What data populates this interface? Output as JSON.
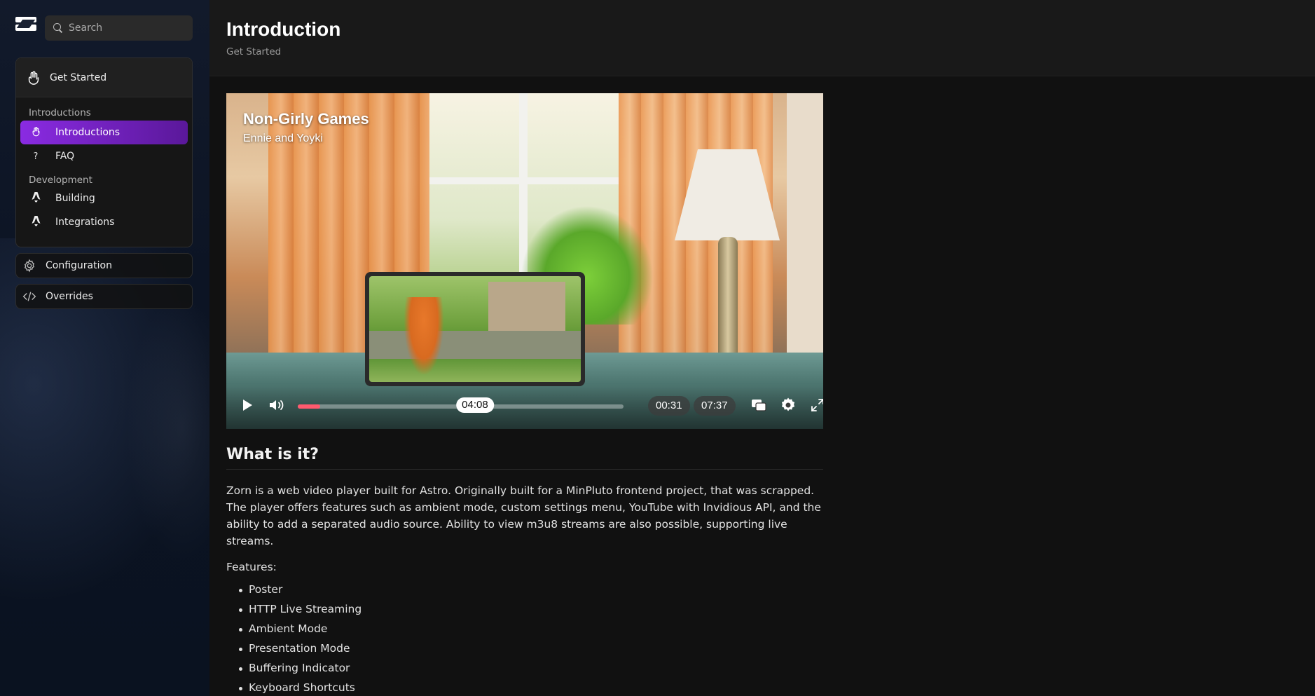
{
  "sidebar": {
    "search": {
      "placeholder": "Search"
    },
    "group": {
      "title": "Get Started",
      "sections": [
        {
          "title": "Introductions",
          "items": [
            {
              "label": "Introductions",
              "icon": "hand-icon",
              "active": true
            },
            {
              "label": "FAQ",
              "icon": "question-icon",
              "active": false
            }
          ]
        },
        {
          "title": "Development",
          "items": [
            {
              "label": "Building",
              "icon": "astro-icon",
              "active": false
            },
            {
              "label": "Integrations",
              "icon": "astro-icon",
              "active": false
            }
          ]
        }
      ]
    },
    "top_items": [
      {
        "label": "Configuration",
        "icon": "gear-icon"
      },
      {
        "label": "Overrides",
        "icon": "code-icon"
      }
    ]
  },
  "header": {
    "title": "Introduction",
    "breadcrumb": "Get Started"
  },
  "video": {
    "title": "Non-Girly Games",
    "subtitle": "Ennie and Yoyki",
    "progress_fraction": 0.068,
    "hover_fraction": 0.544,
    "hover_time": "04:08",
    "current_time": "00:31",
    "duration": "07:37",
    "accent_color": "#ff5a6e"
  },
  "content": {
    "heading": "What is it?",
    "paragraph": "Zorn is a web video player built for Astro. Originally built for a MinPluto frontend project, that was scrapped. The player offers features such as ambient mode, custom settings menu, YouTube with Invidious API, and the ability to add a separated audio source. Ability to view m3u8 streams are also possible, supporting live streams.",
    "features_label": "Features:",
    "features": [
      "Poster",
      "HTTP Live Streaming",
      "Ambient Mode",
      "Presentation Mode",
      "Buffering Indicator",
      "Keyboard Shortcuts"
    ]
  },
  "colors": {
    "active_nav": "#8a2be2",
    "background": "#111111"
  }
}
